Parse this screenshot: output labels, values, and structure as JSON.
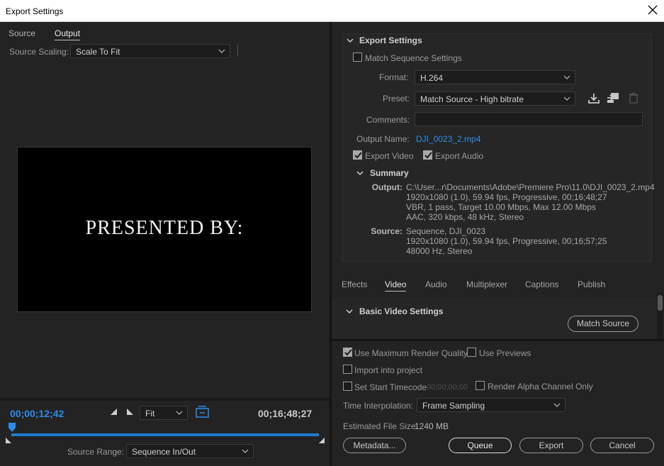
{
  "window": {
    "title": "Export Settings"
  },
  "left": {
    "tabs": [
      "Source",
      "Output"
    ],
    "active_tab": "Output",
    "source_scaling_label": "Source Scaling:",
    "source_scaling_value": "Scale To Fit",
    "preview_text": "PRESENTED BY:",
    "timecode_current": "00;00;12;42",
    "timecode_duration": "00;16;48;27",
    "zoom_value": "Fit",
    "source_range_label": "Source Range:",
    "source_range_value": "Sequence In/Out"
  },
  "export_settings": {
    "heading": "Export Settings",
    "match_sequence_label": "Match Sequence Settings",
    "match_sequence_checked": false,
    "format_label": "Format:",
    "format_value": "H.264",
    "preset_label": "Preset:",
    "preset_value": "Match Source - High bitrate",
    "comments_label": "Comments:",
    "comments_value": "",
    "output_name_label": "Output Name:",
    "output_name_value": "DJI_0023_2.mp4",
    "export_video_label": "Export Video",
    "export_video_checked": true,
    "export_audio_label": "Export Audio",
    "export_audio_checked": true
  },
  "summary": {
    "heading": "Summary",
    "output_label": "Output:",
    "output_lines": [
      "C:\\User...r\\Documents\\Adobe\\Premiere Pro\\11.0\\DJI_0023_2.mp4",
      "1920x1080 (1.0), 59.94 fps, Progressive, 00;16;48;27",
      "VBR, 1 pass, Target 10.00 Mbps, Max 12.00 Mbps",
      "AAC, 320 kbps, 48 kHz, Stereo"
    ],
    "source_label": "Source:",
    "source_lines": [
      "Sequence, DJI_0023",
      "1920x1080 (1.0), 59.94 fps, Progressive, 00;16;57;25",
      "48000 Hz, Stereo"
    ]
  },
  "settings_tabs": [
    "Effects",
    "Video",
    "Audio",
    "Multiplexer",
    "Captions",
    "Publish"
  ],
  "active_settings_tab": "Video",
  "video": {
    "heading": "Basic Video Settings",
    "match_source_button": "Match Source"
  },
  "options": {
    "max_render_quality_label": "Use Maximum Render Quality",
    "max_render_quality_checked": true,
    "use_previews_label": "Use Previews",
    "use_previews_checked": false,
    "import_into_project_label": "Import into project",
    "import_into_project_checked": false,
    "set_start_timecode_label": "Set Start Timecode",
    "set_start_timecode_checked": false,
    "start_timecode_value": "00;00;00;00",
    "render_alpha_label": "Render Alpha Channel Only",
    "render_alpha_checked": false,
    "time_interpolation_label": "Time Interpolation:",
    "time_interpolation_value": "Frame Sampling",
    "estimated_size_label": "Estimated File Size:",
    "estimated_size_value": "1240 MB"
  },
  "buttons": {
    "metadata": "Metadata...",
    "queue": "Queue",
    "export": "Export",
    "cancel": "Cancel"
  },
  "colors": {
    "accent_blue": "#2d8ceb",
    "panel_bg": "#232323",
    "preview_bg": "#000000"
  }
}
